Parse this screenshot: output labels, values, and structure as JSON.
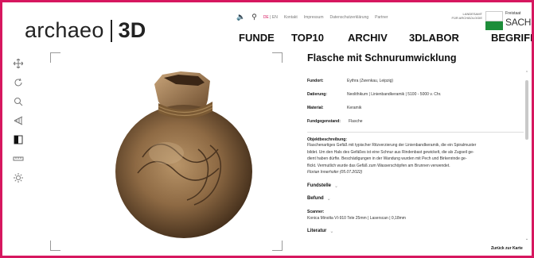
{
  "brand": {
    "left": "archaeo",
    "right": "3D"
  },
  "utility": {
    "lang_active": "DE",
    "lang_sep": "|",
    "lang_other": "EN",
    "links": [
      "Kontakt",
      "Impressum",
      "Datenschutzerklärung",
      "Partner",
      "FÜR ARCHÄOLOGIE"
    ]
  },
  "seal": {
    "top_left": "LANDESAMT",
    "frei": "Freistaat",
    "name": "SACHSEN"
  },
  "nav": [
    "FUNDE",
    "TOP10",
    "ARCHIV",
    "3DLABOR",
    "BEGRIFFE"
  ],
  "tools": [
    "move-icon",
    "rotate-icon",
    "zoom-icon",
    "perspective-icon",
    "contrast-icon",
    "measure-icon",
    "light-icon"
  ],
  "colors": {
    "accent": "#d6175f",
    "seal_green": "#1d8d3a"
  },
  "object": {
    "title": "Flasche mit Schnurumwicklung",
    "meta": [
      {
        "label": "Fundort:",
        "value": "Eythra (Zwenkau, Leipzig)"
      },
      {
        "label": "Datierung:",
        "value": "Neolithikum | Linienbandkeramik | 5100 - 5000 v. Chr."
      },
      {
        "label": "Material:",
        "value": "Keramik"
      },
      {
        "label": "Fundgegenstand:",
        "value": "Flasche"
      }
    ],
    "description_label": "Objektbeschreibung:",
    "description_lines": [
      "Flaschenartiges Gefäß mit typischer Ritzverzierung der Linienbandkeramik, die ein Spiralmuster",
      "bildet. Um den Hals des Gefäßes ist eine Schnur aus Rindenbast gewickelt, die als Zugseil ge-",
      "dient haben dürfte. Beschädigungen in der Wandung wurden mit Pech und Birkenrinde ge-",
      "flickt. Vermutlich wurde das Gefäß zum Wasserschöpfen am Brunnen verwendet."
    ],
    "author": "Florian Innerhofer (05.07.2022)",
    "sections": {
      "fundstelle": "Fundstelle",
      "befund": "Befund",
      "literatur": "Literatur"
    },
    "scanner_label": "Scanner:",
    "scanner_value": "Konica Minolta VI-910 Tele 25mm | Laserscan | 0,18mm"
  },
  "back_link": "Zurück zur Karte"
}
